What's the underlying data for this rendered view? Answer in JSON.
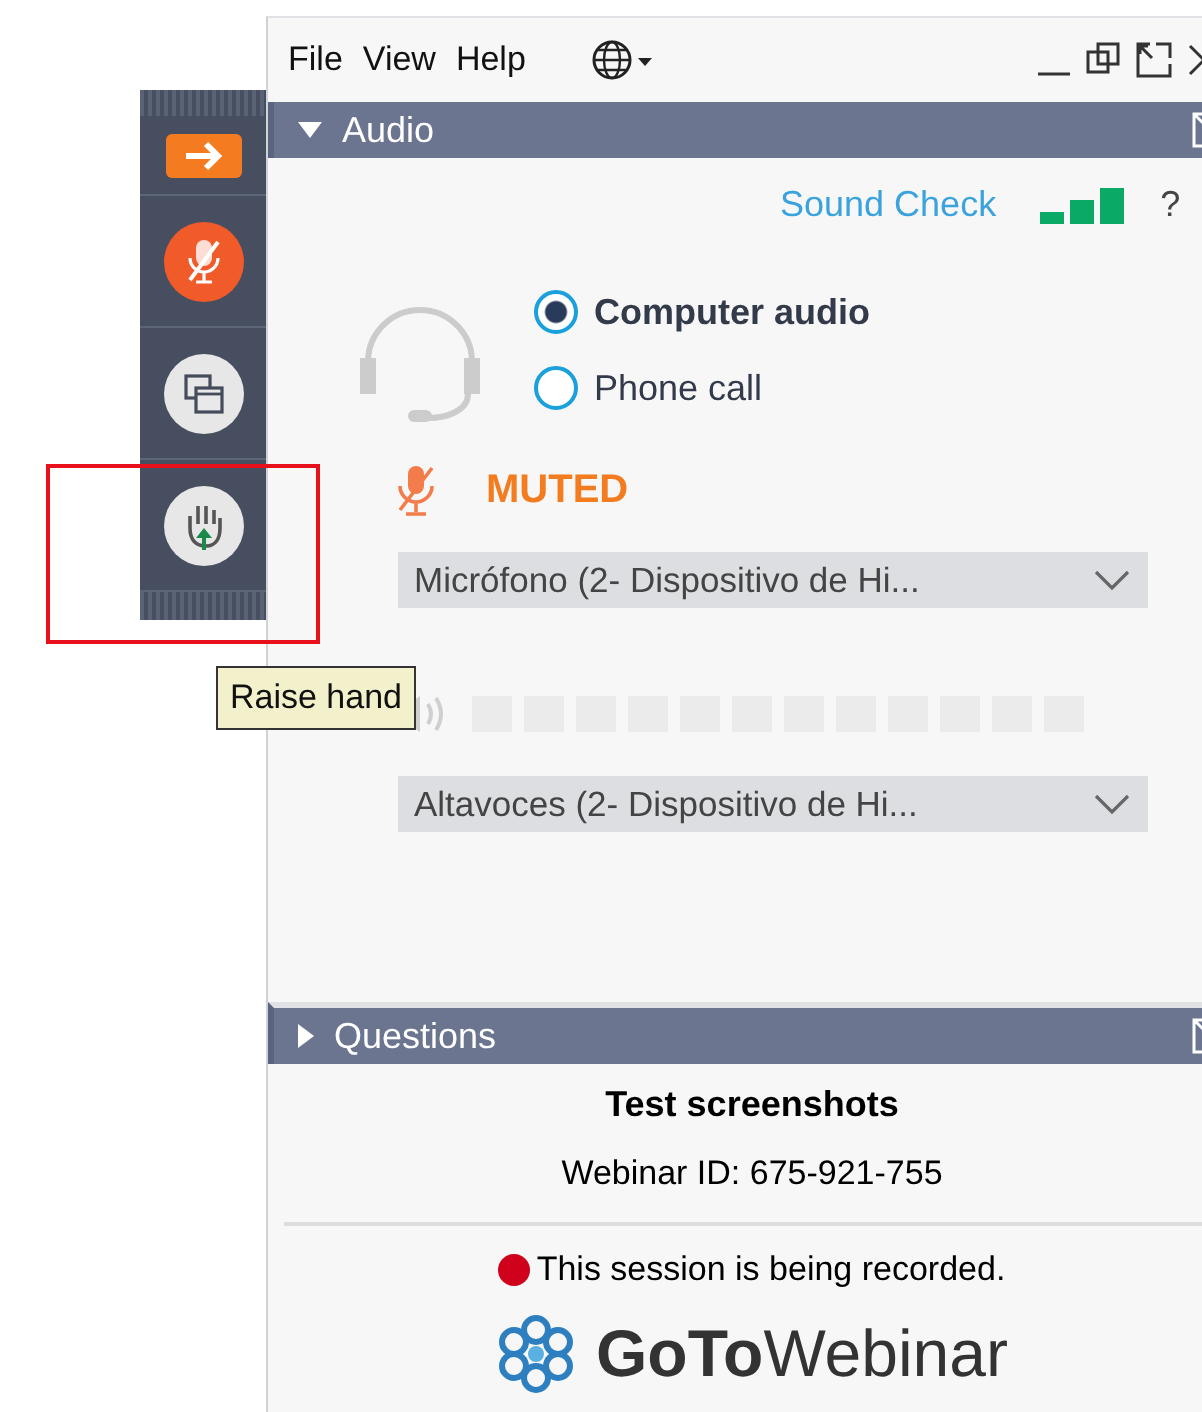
{
  "toolbar": [
    {
      "kind": "arrow"
    },
    {
      "kind": "mute"
    },
    {
      "kind": "screen"
    },
    {
      "kind": "hand"
    }
  ],
  "tooltip": "Raise hand",
  "menu": [
    "File",
    "View",
    "Help"
  ],
  "audio": {
    "title": "Audio",
    "expanded": true,
    "sound_check": "Sound Check",
    "help": "?",
    "options": [
      {
        "label": "Computer audio",
        "selected": true
      },
      {
        "label": "Phone call",
        "selected": false
      }
    ],
    "mic_status": "MUTED",
    "microphone": "Micrófono (2- Dispositivo de Hi...",
    "speaker_meter": {
      "level": 0
    },
    "speaker": "Altavoces (2- Dispositivo de Hi..."
  },
  "questions": {
    "title": "Questions",
    "expanded": false
  },
  "session": {
    "title": "Test screenshots",
    "webinar_id": "Webinar ID: 675-921-755",
    "recording": "This session is being recorded.",
    "logo": "**GoTo**Webinar"
  }
}
